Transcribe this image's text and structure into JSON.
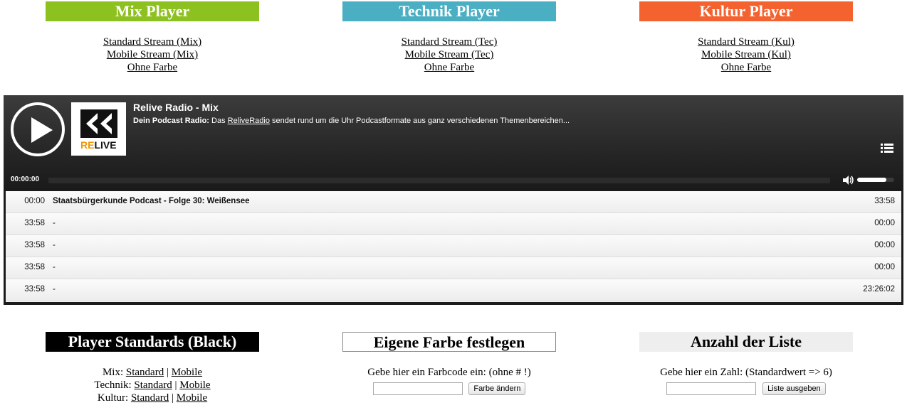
{
  "players": [
    {
      "title": "Mix Player",
      "color": "#8dc11f",
      "links": [
        "Standard Stream (Mix)",
        "Mobile Stream (Mix)",
        "Ohne Farbe"
      ]
    },
    {
      "title": "Technik Player",
      "color": "#4aafc3",
      "links": [
        "Standard Stream (Tec)",
        "Mobile Stream (Tec)",
        "Ohne Farbe"
      ]
    },
    {
      "title": "Kultur Player",
      "color": "#f4622f",
      "links": [
        "Standard Stream (Kul)",
        "Mobile Stream (Kul)",
        "Ohne Farbe"
      ]
    }
  ],
  "player": {
    "station": "Relive Radio - Mix",
    "desc_bold": "Dein Podcast Radio:",
    "desc_pre": " Das ",
    "desc_link": "ReliveRadio",
    "desc_post": " sendet rund um die Uhr Podcastformate aus ganz verschiedenen Themenbereichen...",
    "logo_re": "RE",
    "logo_live": "LIVE",
    "current_time": "00:00:00",
    "volume_level": 0.78,
    "play_icon": "play-icon",
    "list_icon": "playlist-icon",
    "volume_icon": "speaker-icon"
  },
  "playlist": [
    {
      "start": "00:00",
      "title": "Staatsbürgerkunde Podcast - Folge 30: Weißensee",
      "duration": "33:58"
    },
    {
      "start": "33:58",
      "title": "-",
      "duration": "00:00"
    },
    {
      "start": "33:58",
      "title": "-",
      "duration": "00:00"
    },
    {
      "start": "33:58",
      "title": "-",
      "duration": "00:00"
    },
    {
      "start": "33:58",
      "title": "-",
      "duration": "23:26:02"
    }
  ],
  "standards": {
    "title": "Player Standards (Black)",
    "rows": [
      {
        "label": "Mix:",
        "standard": "Standard",
        "sep": "|",
        "mobile": "Mobile"
      },
      {
        "label": "Technik:",
        "standard": "Standard",
        "sep": "|",
        "mobile": "Mobile"
      },
      {
        "label": "Kultur:",
        "standard": "Standard",
        "sep": "|",
        "mobile": "Mobile"
      }
    ]
  },
  "color_box": {
    "title": "Eigene Farbe festlegen",
    "prompt": "Gebe hier ein Farbcode ein: (ohne # !)",
    "input_value": "",
    "button": "Farbe ändern"
  },
  "list_box": {
    "title": "Anzahl der Liste",
    "prompt": "Gebe hier ein Zahl: (Standardwert => 6)",
    "input_value": "",
    "button": "Liste ausgeben"
  }
}
